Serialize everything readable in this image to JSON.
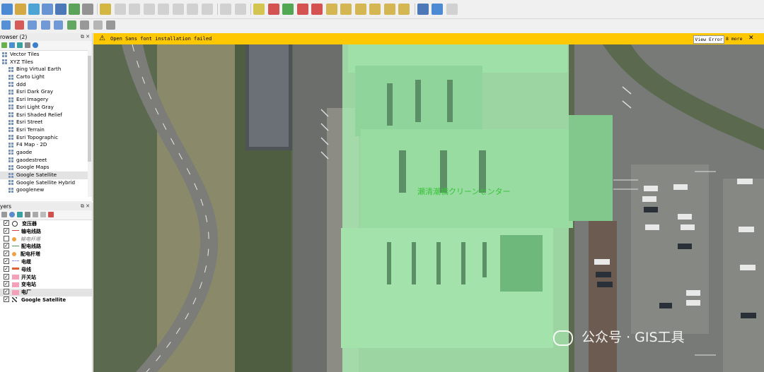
{
  "browser_panel": {
    "title": "rowser (2)",
    "items": [
      {
        "label": "Vector Tiles",
        "indent": 0
      },
      {
        "label": "XYZ Tiles",
        "indent": 0
      },
      {
        "label": "Bing Virtual Earth",
        "indent": 1
      },
      {
        "label": "Carto Light",
        "indent": 1
      },
      {
        "label": "ddd",
        "indent": 1
      },
      {
        "label": "Esri Dark Gray",
        "indent": 1
      },
      {
        "label": "Esri Imagery",
        "indent": 1
      },
      {
        "label": "Esri Light Gray",
        "indent": 1
      },
      {
        "label": "Esri Shaded Relief",
        "indent": 1
      },
      {
        "label": "Esri Street",
        "indent": 1
      },
      {
        "label": "Esri Terrain",
        "indent": 1
      },
      {
        "label": "Esri Topographic",
        "indent": 1
      },
      {
        "label": "F4 Map - 2D",
        "indent": 1
      },
      {
        "label": "gaode",
        "indent": 1
      },
      {
        "label": "gaodestreet",
        "indent": 1
      },
      {
        "label": "Google Maps",
        "indent": 1
      },
      {
        "label": "Google Satellite",
        "indent": 1,
        "selected": true
      },
      {
        "label": "Google Satellite Hybrid",
        "indent": 1
      },
      {
        "label": "googlenew",
        "indent": 1
      }
    ]
  },
  "layers_panel": {
    "title": "yers",
    "layers": [
      {
        "label": "变压器",
        "checked": true,
        "symbol": "circle",
        "color": "#333333"
      },
      {
        "label": "输电线路",
        "checked": true,
        "symbol": "line",
        "color": "#d04040"
      },
      {
        "label": "输电杆塔",
        "checked": false,
        "symbol": "dot",
        "color": "#f0a040",
        "dim": true
      },
      {
        "label": "配电线路",
        "checked": true,
        "symbol": "line",
        "color": "#5a9a5a"
      },
      {
        "label": "配电杆塔",
        "checked": true,
        "symbol": "dot",
        "color": "#f0a040"
      },
      {
        "label": "电缆",
        "checked": true,
        "symbol": "dashline",
        "color": "#8a8ae0"
      },
      {
        "label": "母线",
        "checked": true,
        "symbol": "thickline",
        "color": "#e06030"
      },
      {
        "label": "开关站",
        "checked": true,
        "symbol": "fill",
        "color": "#f4a0b8"
      },
      {
        "label": "变电站",
        "checked": true,
        "symbol": "fill",
        "color": "#f4a0b8"
      },
      {
        "label": "电厂",
        "checked": true,
        "symbol": "fill",
        "color": "#f4a0b8",
        "selected": true
      },
      {
        "label": "Google Satellite",
        "checked": true,
        "symbol": "raster",
        "color": "#444444"
      }
    ]
  },
  "message_bar": {
    "message": "Open Sans font installation failed",
    "view_button": "View Error",
    "more": "8 more",
    "close": "✕"
  },
  "map": {
    "building_label": "瀬清潮橋クリーンセンター",
    "watermark": "公众号 · GIS工具"
  },
  "colors": {
    "message_bar": "#ffc800",
    "building_overlay": "#a8e8b0",
    "road": "#7a7a7a"
  }
}
